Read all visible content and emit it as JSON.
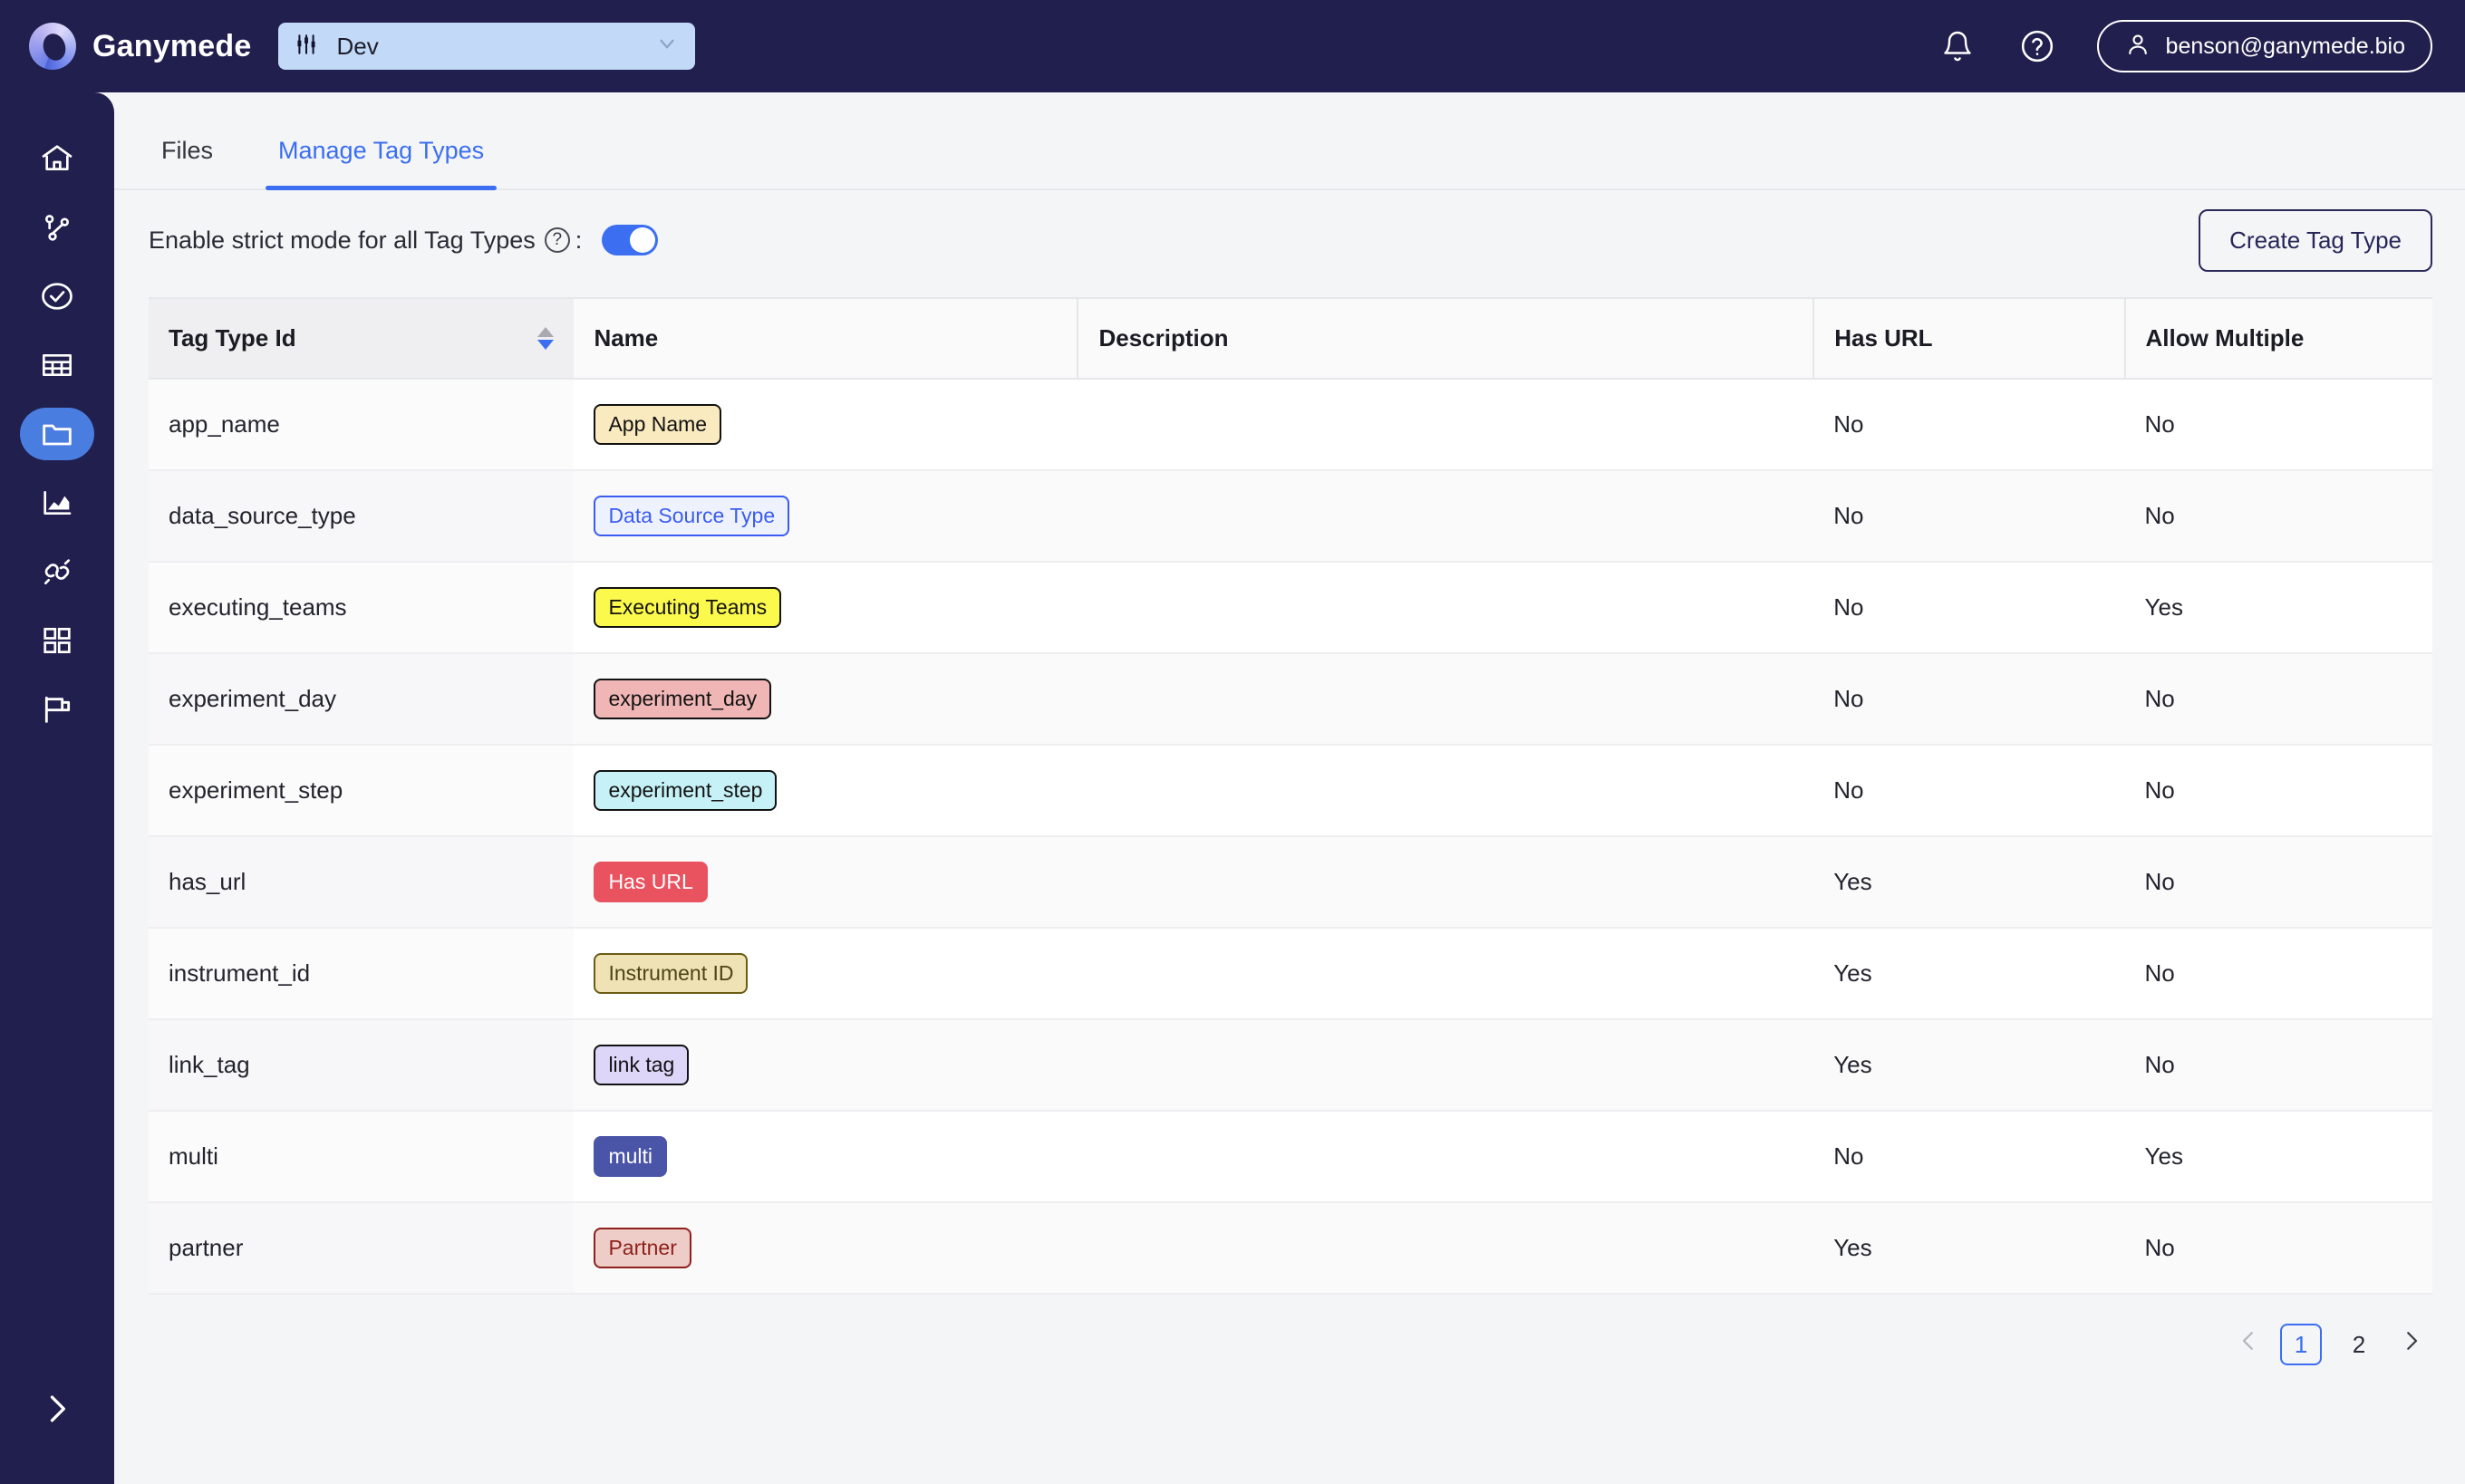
{
  "app": {
    "brand": "Ganymede",
    "env_selector": {
      "value": "Dev",
      "icon": "sliders-icon",
      "caret": "chevron-down-icon"
    },
    "user_email": "benson@ganymede.bio",
    "notification_icon": "bell-icon",
    "help_icon": "question-circle-icon"
  },
  "sidebar": {
    "items": [
      {
        "name": "home",
        "icon": "home-icon",
        "active": false
      },
      {
        "name": "flows",
        "icon": "git-branch-icon",
        "active": false
      },
      {
        "name": "runs",
        "icon": "check-circle-icon",
        "active": false
      },
      {
        "name": "tables",
        "icon": "table-icon",
        "active": false
      },
      {
        "name": "files",
        "icon": "folder-icon",
        "active": true
      },
      {
        "name": "analytics",
        "icon": "chart-area-icon",
        "active": false
      },
      {
        "name": "connections",
        "icon": "plug-icon",
        "active": false
      },
      {
        "name": "apps",
        "icon": "grid-apps-icon",
        "active": false
      },
      {
        "name": "flags",
        "icon": "flag-icon",
        "active": false
      }
    ],
    "expand_icon": "chevron-right-icon"
  },
  "tabs": [
    {
      "label": "Files",
      "active": false
    },
    {
      "label": "Manage Tag Types",
      "active": true
    }
  ],
  "toolbar": {
    "strict_mode_label": "Enable strict mode for all Tag Types",
    "strict_mode_suffix": ":",
    "strict_mode_on": true,
    "help_glyph": "?",
    "create_label": "Create Tag Type"
  },
  "table": {
    "columns": [
      "Tag Type Id",
      "Name",
      "Description",
      "Has URL",
      "Allow Multiple"
    ],
    "sorted_column": "Tag Type Id",
    "sort_direction": "desc",
    "rows": [
      {
        "id": "app_name",
        "name": "App Name",
        "description": "",
        "has_url": "No",
        "allow_multiple": "No",
        "badge": {
          "bg": "#faeac0",
          "border": "#121212",
          "text": "#121212"
        }
      },
      {
        "id": "data_source_type",
        "name": "Data Source Type",
        "description": "",
        "has_url": "No",
        "allow_multiple": "No",
        "badge": {
          "bg": "#eef2ff",
          "border": "#3b5cf0",
          "text": "#3b5cf0"
        }
      },
      {
        "id": "executing_teams",
        "name": "Executing Teams",
        "description": "",
        "has_url": "No",
        "allow_multiple": "Yes",
        "badge": {
          "bg": "#fbf94b",
          "border": "#121212",
          "text": "#121212"
        }
      },
      {
        "id": "experiment_day",
        "name": "experiment_day",
        "description": "",
        "has_url": "No",
        "allow_multiple": "No",
        "badge": {
          "bg": "#f0b6b6",
          "border": "#121212",
          "text": "#121212"
        }
      },
      {
        "id": "experiment_step",
        "name": "experiment_step",
        "description": "",
        "has_url": "No",
        "allow_multiple": "No",
        "badge": {
          "bg": "#c6f2f7",
          "border": "#121212",
          "text": "#121212"
        }
      },
      {
        "id": "has_url",
        "name": "Has URL",
        "description": "",
        "has_url": "Yes",
        "allow_multiple": "No",
        "badge": {
          "bg": "#e8535f",
          "border": "#e8535f",
          "text": "#ffffff"
        }
      },
      {
        "id": "instrument_id",
        "name": "Instrument ID",
        "description": "",
        "has_url": "Yes",
        "allow_multiple": "No",
        "badge": {
          "bg": "#efe2b4",
          "border": "#6b5c14",
          "text": "#4c4415"
        }
      },
      {
        "id": "link_tag",
        "name": "link tag",
        "description": "",
        "has_url": "Yes",
        "allow_multiple": "No",
        "badge": {
          "bg": "#ddd6f8",
          "border": "#121212",
          "text": "#121212"
        }
      },
      {
        "id": "multi",
        "name": "multi",
        "description": "",
        "has_url": "No",
        "allow_multiple": "Yes",
        "badge": {
          "bg": "#4a55a8",
          "border": "#4a55a8",
          "text": "#ffffff"
        }
      },
      {
        "id": "partner",
        "name": "Partner",
        "description": "",
        "has_url": "Yes",
        "allow_multiple": "No",
        "badge": {
          "bg": "#eecdc9",
          "border": "#8e1f1a",
          "text": "#8e1f1a"
        }
      }
    ]
  },
  "pagination": {
    "prev_icon": "chevron-left-icon",
    "next_icon": "chevron-right-icon",
    "pages": [
      "1",
      "2"
    ],
    "current_page": "1"
  },
  "colors": {
    "navy": "#211f4d",
    "accent_blue": "#3b6ef0",
    "env_chip": "#c2d9f7",
    "page_bg": "#f4f5f7"
  }
}
